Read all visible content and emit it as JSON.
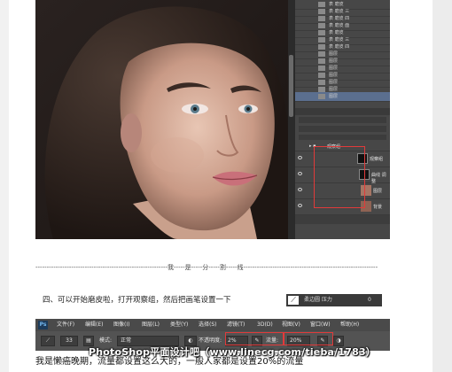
{
  "history_panel": {
    "items": [
      "表 磨皮",
      "表 磨皮 三",
      "表 磨皮 四",
      "表 磨皮 面",
      "表 磨皮",
      "表 磨皮 三",
      "表 磨皮 四",
      "图层",
      "图层",
      "图层",
      "图层",
      "图层",
      "图层",
      "图层"
    ],
    "selected_label": "图层"
  },
  "layers_panel": {
    "group_label": "观察组",
    "layers": [
      {
        "name": "观察组"
      },
      {
        "name": "曲线 调整"
      },
      {
        "name": "图层"
      },
      {
        "name": "背景"
      }
    ]
  },
  "divider_text": "-----------------------------------------------------------我-----是-----分-----割-----线------------------------------------------------------------",
  "step_text": "四、可以开始磨皮啦，打开观察组，然后把画笔设置一下",
  "brush_preset_label": "柔边圆 压力",
  "brush_size": "0",
  "ps_menu": {
    "logo": "Ps",
    "items": [
      "文件(F)",
      "编辑(E)",
      "图像(I)",
      "图层(L)",
      "类型(Y)",
      "选择(S)",
      "滤镜(T)",
      "3D(D)",
      "视图(V)",
      "窗口(W)",
      "帮助(H)"
    ]
  },
  "options_bar": {
    "brush_size": "33",
    "mode_label": "模式:",
    "mode_value": "正常",
    "opacity_label": "不透明度:",
    "opacity_value": "2%",
    "flow_label": "流量:",
    "flow_value": "20%"
  },
  "bottom_text": "我是懒癌晚期，流量都设置这么大的，一般人家都是设置20%的流量",
  "watermark": "PhotoShop平面设计吧（www.linecg.com/tieba/1783）",
  "colors": {
    "highlight_red": "#e23a3a",
    "ps_dark": "#474747"
  }
}
